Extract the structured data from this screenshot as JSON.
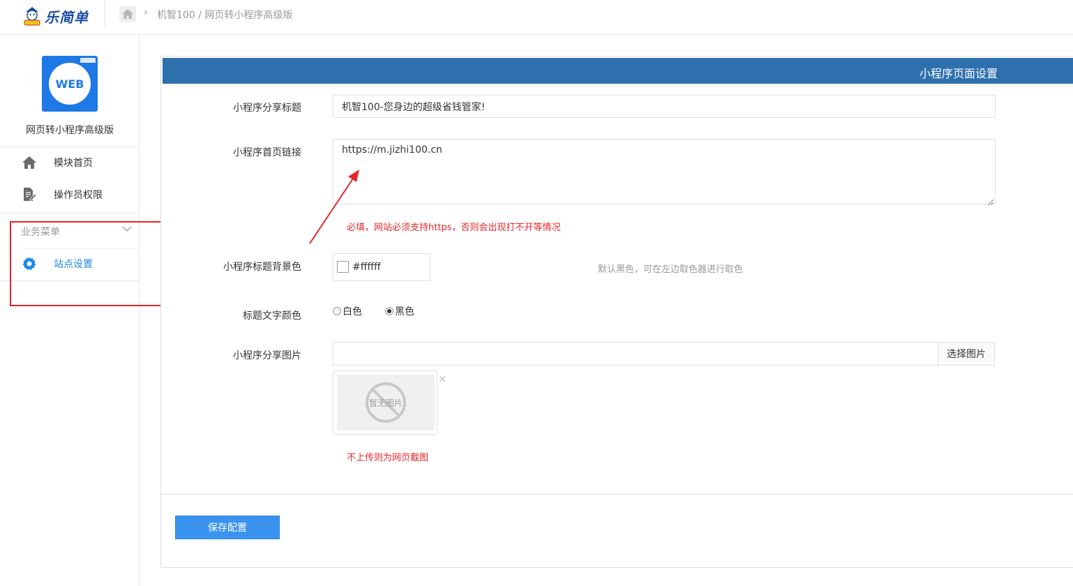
{
  "header": {
    "logo_text": "乐简单",
    "breadcrumb": "机智100 / 网页转小程序高级版"
  },
  "sidebar": {
    "app_icon_text": "WEB",
    "app_name": "网页转小程序高级版",
    "items": [
      {
        "label": "模块首页",
        "icon": "home-icon"
      },
      {
        "label": "操作员权限",
        "icon": "document-edit-icon"
      }
    ],
    "group_title": "业务菜单",
    "group_items": [
      {
        "label": "站点设置",
        "icon": "gear-icon",
        "active": true
      }
    ]
  },
  "panel": {
    "title": "小程序页面设置"
  },
  "form": {
    "share_title_label": "小程序分享标题",
    "share_title_value": "机智100-您身边的超级省钱管家!",
    "home_link_label": "小程序首页链接",
    "home_link_value": "https://m.jizhi100.cn",
    "home_link_hint": "必填，网站必须支持https，否则会出现打不开等情况",
    "title_bg_label": "小程序标题背景色",
    "title_bg_value": "#ffffff",
    "title_bg_hint": "默认黑色，可在左边取色器进行取色",
    "title_color_label": "标题文字颜色",
    "title_color_options": [
      "白色",
      "黑色"
    ],
    "title_color_selected": "黑色",
    "share_image_label": "小程序分享图片",
    "share_image_value": "",
    "choose_image_label": "选择图片",
    "no_image_text": "暂无图片",
    "close_glyph": "×",
    "share_image_hint": "不上传则为网页截图"
  },
  "actions": {
    "save_label": "保存配置"
  },
  "colors": {
    "header_blue": "#2e70ad",
    "accent_blue": "#1e88e5",
    "button_blue": "#3a94ef",
    "annotation_red": "#e5262b"
  }
}
